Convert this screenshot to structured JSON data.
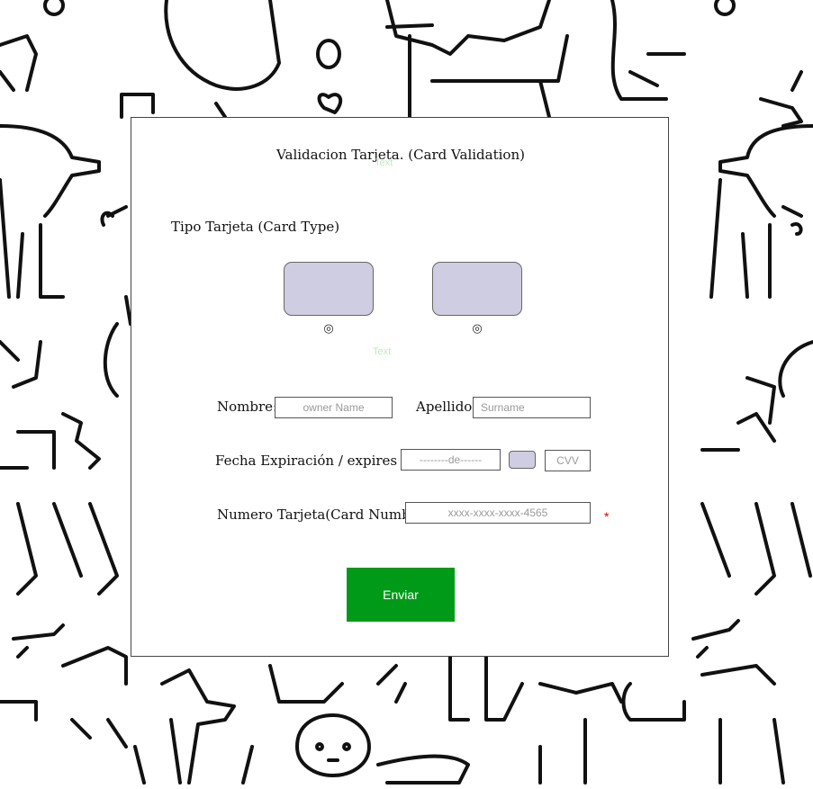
{
  "form": {
    "title": "Validacion Tarjeta. (Card Validation)",
    "ghost_text": "Text",
    "card_type_label": "Tipo Tarjeta (Card Type)",
    "radio_glyph": "◎",
    "name_label": "Nombre:",
    "name_placeholder": "owner Name",
    "surname_label": "Apellido:",
    "surname_placeholder": "Surname",
    "expiry_label": "Fecha Expiración / expires on",
    "expiry_placeholder": "--------de------",
    "cvv_placeholder": "CVV",
    "card_number_label": "Numero Tarjeta(Card Number)",
    "card_number_placeholder": "xxxx-xxxx-xxxx-4565",
    "required_mark": "*",
    "submit_label": "Enviar"
  },
  "colors": {
    "card_button": "#cfcde2",
    "submit": "#009a19",
    "required": "#d40000"
  }
}
